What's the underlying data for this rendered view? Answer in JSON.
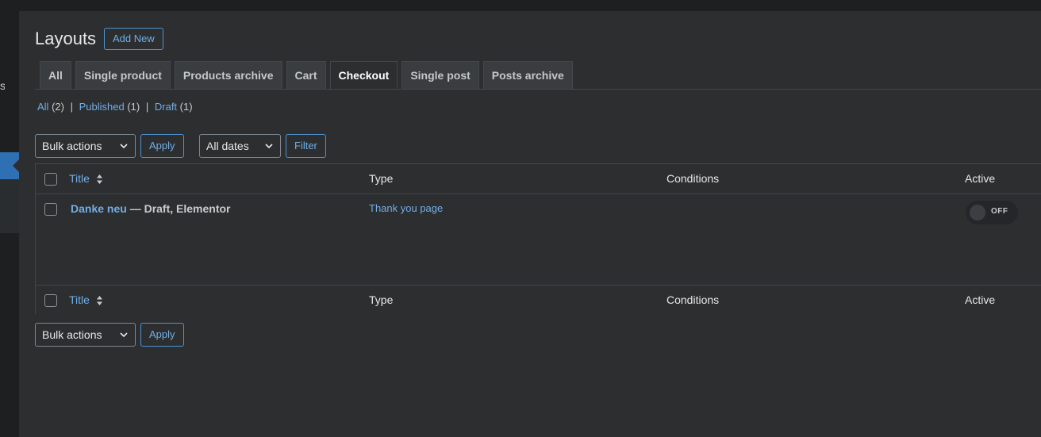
{
  "sidebar": {
    "fragment": "s"
  },
  "page": {
    "title": "Layouts",
    "add_new_label": "Add New"
  },
  "tabs": [
    {
      "label": "All",
      "active": false
    },
    {
      "label": "Single product",
      "active": false
    },
    {
      "label": "Products archive",
      "active": false
    },
    {
      "label": "Cart",
      "active": false
    },
    {
      "label": "Checkout",
      "active": true
    },
    {
      "label": "Single post",
      "active": false
    },
    {
      "label": "Posts archive",
      "active": false
    }
  ],
  "status_links": [
    {
      "label": "All",
      "count": "(2)"
    },
    {
      "label": "Published",
      "count": "(1)"
    },
    {
      "label": "Draft",
      "count": "(1)"
    }
  ],
  "toolbar_top": {
    "bulk_actions": "Bulk actions",
    "apply": "Apply",
    "dates": "All dates",
    "filter": "Filter"
  },
  "table": {
    "columns": {
      "title": "Title",
      "type": "Type",
      "conditions": "Conditions",
      "active": "Active"
    },
    "rows": [
      {
        "title": "Danke neu",
        "state": " — Draft, Elementor",
        "type": "Thank you page",
        "conditions": "",
        "active": "OFF"
      }
    ]
  },
  "toolbar_bottom": {
    "bulk_actions": "Bulk actions",
    "apply": "Apply"
  },
  "colors": {
    "accent": "#72aee6",
    "active_menu": "#2f6fb3",
    "background": "#2c2e30"
  }
}
